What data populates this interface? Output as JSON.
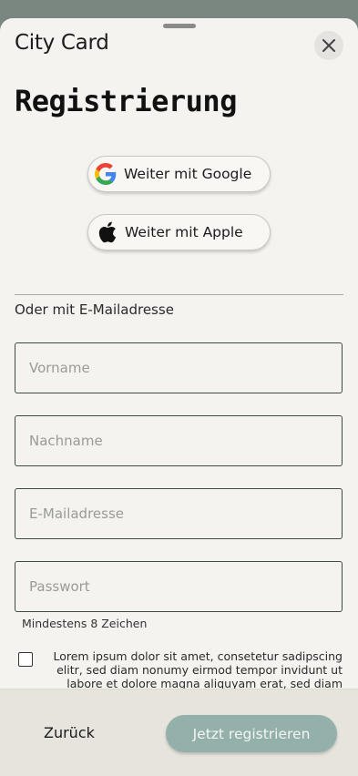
{
  "sheet": {
    "title": "City Card",
    "close_icon": "close-icon"
  },
  "page": {
    "heading": "Registrierung"
  },
  "social": {
    "google_label": "Weiter mit Google",
    "google_icon": "google-logo-icon",
    "apple_label": "Weiter mit Apple",
    "apple_icon": "apple-logo-icon"
  },
  "form": {
    "or_label": "Oder mit E-Mailadresse",
    "first_name": {
      "placeholder": "Vorname",
      "value": ""
    },
    "last_name": {
      "placeholder": "Nachname",
      "value": ""
    },
    "email": {
      "placeholder": "E-Mailadresse",
      "value": ""
    },
    "password": {
      "placeholder": "Passwort",
      "value": ""
    },
    "password_hint": "Mindestens 8 Zeichen",
    "terms_checked": false,
    "terms_text": "Lorem ipsum dolor sit amet, consetetur sadipscing elitr, sed diam nonumy eirmod tempor invidunt ut labore et dolore magna aliquyam erat, sed diam"
  },
  "footer": {
    "back_label": "Zurück",
    "submit_label": "Jetzt registrieren"
  },
  "colors": {
    "accent": "#94b0ab",
    "background": "#f4f3ef",
    "footer": "#e7e4dd"
  }
}
